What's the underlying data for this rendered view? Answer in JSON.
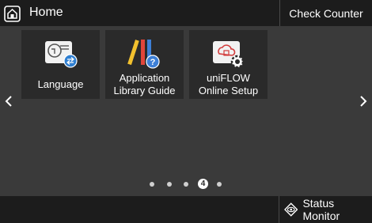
{
  "header": {
    "title": "Home",
    "check_counter_label": "Check Counter"
  },
  "tiles": [
    {
      "label": "Language",
      "icon": "language-icon"
    },
    {
      "label": "Application Library Guide",
      "icon": "library-guide-icon"
    },
    {
      "label": "uniFLOW Online Setup",
      "icon": "uniflow-setup-icon"
    }
  ],
  "pagination": {
    "total_pages": 5,
    "current_page": "4"
  },
  "footer": {
    "status_monitor_label": "Status Monitor"
  },
  "colors": {
    "background": "#3a3a3a",
    "bar": "#1c1c1c",
    "tile": "#2a2a2a",
    "accent_blue": "#2f7fd1"
  }
}
